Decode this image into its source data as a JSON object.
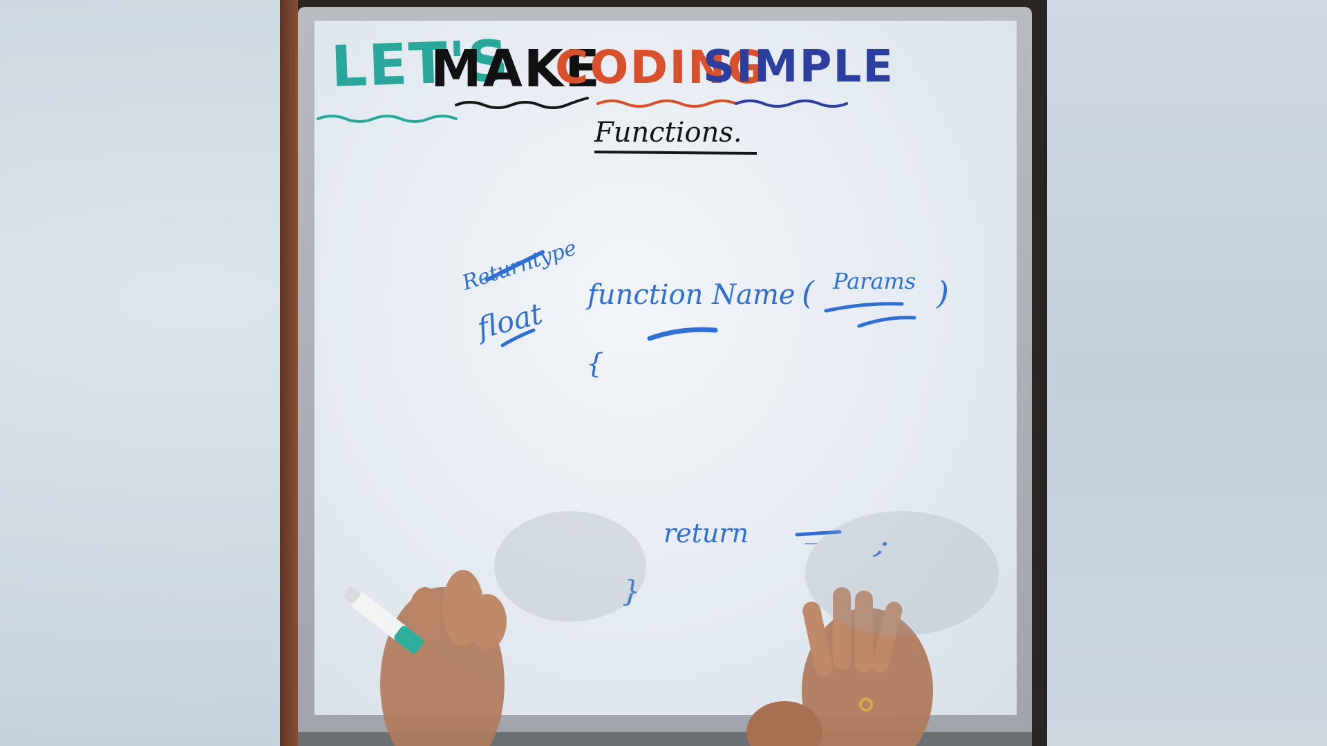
{
  "board": {
    "title_words": [
      "LET'S",
      "MAKE",
      "CODING",
      "SIMPLE"
    ],
    "heading": "Functions.",
    "annotation_top": "Returntype",
    "return_type": "float",
    "signature_name": "function Name",
    "open_paren": "(",
    "params": "Params",
    "close_paren": ")",
    "open_brace": "{",
    "return_keyword": "return",
    "return_blank": "_",
    "semicolon": ";",
    "close_brace": "}"
  },
  "colors": {
    "title_teal": "#2aa79b",
    "title_black": "#111111",
    "title_red": "#d9502d",
    "title_blue": "#2d3f9e",
    "marker_blue": "#2f6fd3",
    "marker_black": "#151515"
  }
}
